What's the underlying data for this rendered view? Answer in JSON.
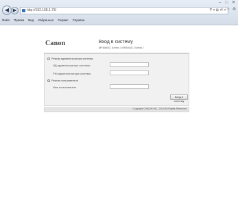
{
  "browser": {
    "url": "http://192.168.1.73/",
    "address_controls": "Ƥ ▾ ⊠ ✕ ✕",
    "back_glyph": "◀",
    "forward_glyph": "▶",
    "window_controls": [
      "–",
      "□",
      "✕"
    ],
    "toolbar_icons": [
      "home-icon",
      "star-icon",
      "gear-icon"
    ],
    "menu": [
      "Файл",
      "Правка",
      "Вид",
      "Избранное",
      "Сервис",
      "Справка"
    ]
  },
  "page": {
    "logo": "Canon",
    "title": "Вход в систему",
    "subtitle": "MF8580C Series / MF8500C Series /",
    "mode_admin_label": "Режим администратора системы",
    "admin_id_label": "ИД администратора системы",
    "admin_pin_label": "PIN администратора системы",
    "mode_general_label": "Режим пользователя",
    "username_label": "Имя пользователя",
    "login_button": "Вход в систему",
    "copyright": "Copyright CANON INC. 2013 All Rights Reserved",
    "selected_mode": "general"
  }
}
